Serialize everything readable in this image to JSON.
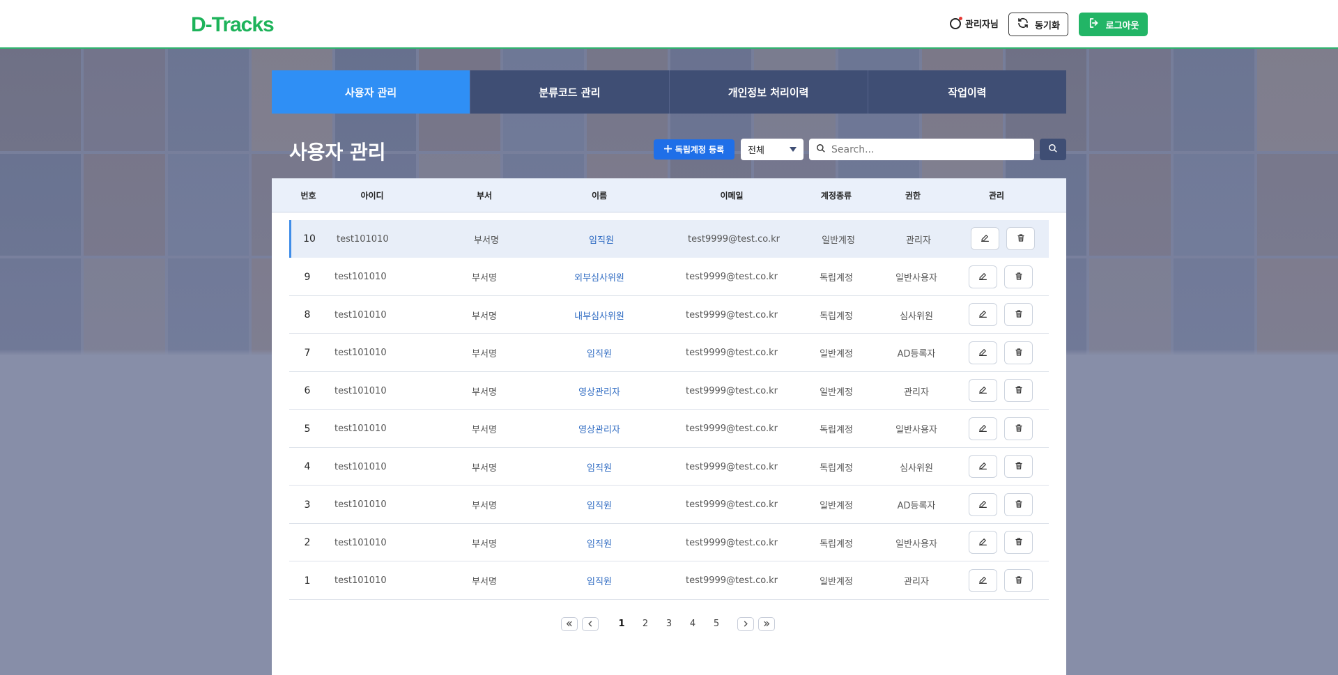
{
  "header": {
    "logo_text": "D-Tracks",
    "user_label": "관리자님",
    "sync_label": "동기화",
    "logout_label": "로그아웃",
    "brand_color": "#22b566"
  },
  "tabs": [
    {
      "label": "사용자 관리",
      "active": true
    },
    {
      "label": "분류코드 관리",
      "active": false
    },
    {
      "label": "개인정보 처리이력",
      "active": false
    },
    {
      "label": "작업이력",
      "active": false
    }
  ],
  "page": {
    "title": "사용자 관리",
    "register_label": "독립계정 등록",
    "filter_selected": "전체",
    "search_placeholder": "Search..."
  },
  "table": {
    "columns": [
      "번호",
      "아이디",
      "부서",
      "이름",
      "이메일",
      "계정종류",
      "권한",
      "관리"
    ],
    "rows": [
      {
        "no": "10",
        "id": "test101010",
        "dept": "부서명",
        "name": "임직원",
        "email": "test9999@test.co.kr",
        "type": "일반계정",
        "role": "관리자",
        "selected": true
      },
      {
        "no": "9",
        "id": "test101010",
        "dept": "부서명",
        "name": "외부심사위원",
        "email": "test9999@test.co.kr",
        "type": "독립계정",
        "role": "일반사용자"
      },
      {
        "no": "8",
        "id": "test101010",
        "dept": "부서명",
        "name": "내부심사위원",
        "email": "test9999@test.co.kr",
        "type": "독립계정",
        "role": "심사위원"
      },
      {
        "no": "7",
        "id": "test101010",
        "dept": "부서명",
        "name": "임직원",
        "email": "test9999@test.co.kr",
        "type": "일반계정",
        "role": "AD등록자"
      },
      {
        "no": "6",
        "id": "test101010",
        "dept": "부서명",
        "name": "영상관리자",
        "email": "test9999@test.co.kr",
        "type": "일반계정",
        "role": "관리자"
      },
      {
        "no": "5",
        "id": "test101010",
        "dept": "부서명",
        "name": "영상관리자",
        "email": "test9999@test.co.kr",
        "type": "독립계정",
        "role": "일반사용자"
      },
      {
        "no": "4",
        "id": "test101010",
        "dept": "부서명",
        "name": "임직원",
        "email": "test9999@test.co.kr",
        "type": "독립계정",
        "role": "심사위원"
      },
      {
        "no": "3",
        "id": "test101010",
        "dept": "부서명",
        "name": "임직원",
        "email": "test9999@test.co.kr",
        "type": "일반계정",
        "role": "AD등록자"
      },
      {
        "no": "2",
        "id": "test101010",
        "dept": "부서명",
        "name": "임직원",
        "email": "test9999@test.co.kr",
        "type": "독립계정",
        "role": "일반사용자"
      },
      {
        "no": "1",
        "id": "test101010",
        "dept": "부서명",
        "name": "임직원",
        "email": "test9999@test.co.kr",
        "type": "일반계정",
        "role": "관리자"
      }
    ]
  },
  "pagination": {
    "pages": [
      "1",
      "2",
      "3",
      "4",
      "5"
    ],
    "current": "1"
  },
  "icons": {
    "sync": "sync-icon",
    "logout": "logout-icon",
    "search": "search-icon",
    "edit": "pencil-icon",
    "delete": "trash-icon"
  }
}
